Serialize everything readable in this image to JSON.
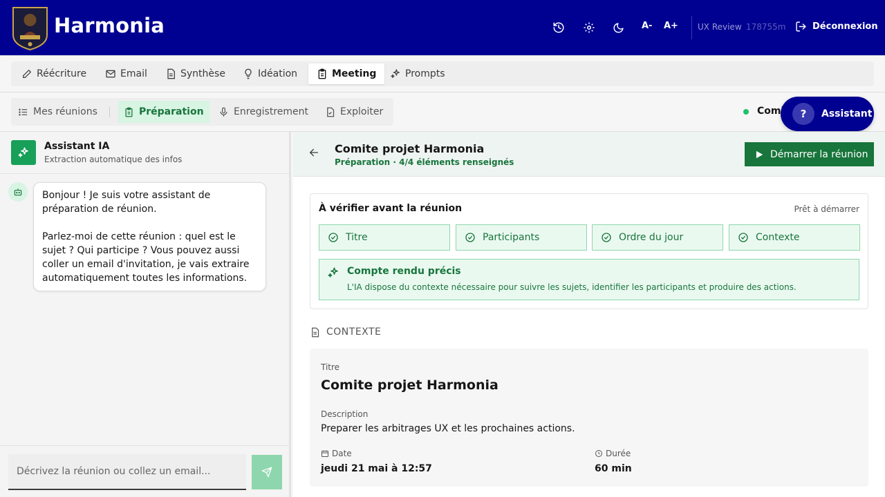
{
  "header": {
    "brand": "Harmonia",
    "font_smaller": "A-",
    "font_larger": "A+",
    "ux_review": "UX Review",
    "ux_counter": "178755m",
    "logout": "Déconnexion"
  },
  "main_tabs": [
    {
      "label": "Réécriture",
      "icon": "pencil-icon"
    },
    {
      "label": "Email",
      "icon": "mail-icon"
    },
    {
      "label": "Synthèse",
      "icon": "document-icon"
    },
    {
      "label": "Idéation",
      "icon": "lightbulb-icon"
    },
    {
      "label": "Meeting",
      "icon": "clipboard-icon",
      "active": true
    },
    {
      "label": "Prompts",
      "icon": "sparkles-icon"
    }
  ],
  "sub_tabs": [
    {
      "label": "Mes réunions",
      "icon": "list-icon"
    },
    {
      "label": "Préparation",
      "icon": "clipboard-icon",
      "active": true
    },
    {
      "label": "Enregistrement",
      "icon": "microphone-icon"
    },
    {
      "label": "Exploiter",
      "icon": "document-icon"
    }
  ],
  "status_text": "Comi",
  "assistant_button": {
    "glyph": "?",
    "label": "Assistant"
  },
  "left_panel": {
    "title": "Assistant IA",
    "subtitle": "Extraction automatique des infos",
    "message_p1": "Bonjour ! Je suis votre assistant de préparation de réunion.",
    "message_p2": "Parlez-moi de cette réunion : quel est le sujet ? Qui participe ? Vous pouvez aussi coller un email d'invitation, je vais extraire automatiquement toutes les informations.",
    "input_placeholder": "Décrivez la réunion ou collez un email..."
  },
  "meeting": {
    "title": "Comite projet Harmonia",
    "subtitle": "Préparation · 4/4 éléments renseignés",
    "start_button": "Démarrer la réunion"
  },
  "verify": {
    "title": "À vérifier avant la réunion",
    "status": "Prêt à démarrer",
    "items": [
      "Titre",
      "Participants",
      "Ordre du jour",
      "Contexte"
    ],
    "precis_title": "Compte rendu précis",
    "precis_text": "L'IA dispose du contexte nécessaire pour suivre les sujets, identifier les participants et produire des actions."
  },
  "context": {
    "label": "CONTEXTE",
    "title_key": "Titre",
    "title_value": "Comite projet Harmonia",
    "description_key": "Description",
    "description_value": "Preparer les arbitrages UX et les prochaines actions.",
    "date_key": "Date",
    "date_value": "jeudi 21 mai à 12:57",
    "duration_key": "Durée",
    "duration_value": "60 min"
  },
  "colors": {
    "header_bg": "#000091",
    "accent_green": "#18753c",
    "light_green": "#eaf9f0"
  }
}
